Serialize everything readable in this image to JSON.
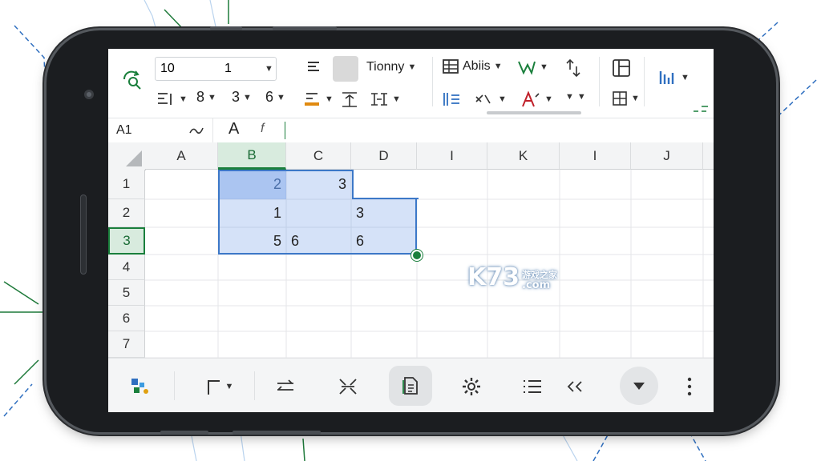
{
  "toolbar": {
    "font_size": "10",
    "font_option": "1",
    "font_name": "Tionny",
    "style_label": "Abiis",
    "row2_num1": "8",
    "row2_num2": "3",
    "row2_num3": "6"
  },
  "formula_bar": {
    "cell_ref": "A1",
    "fx_label": "A",
    "f_icon": "f"
  },
  "sheet": {
    "columns": [
      "A",
      "B",
      "C",
      "D",
      "I",
      "K",
      "I",
      "J"
    ],
    "rows": [
      "1",
      "2",
      "3",
      "4",
      "5",
      "6",
      "7"
    ],
    "cells": {
      "B1": "2",
      "C1": "3",
      "B2": "1",
      "D2": "3",
      "B3": "5",
      "C3": "6",
      "D3": "6"
    },
    "selected_column": "B",
    "selected_row": "3"
  },
  "watermark": {
    "logo": "K73",
    "site_cn": "游戏之家",
    "domain": ".com"
  },
  "icons": {
    "search": "search-icon",
    "settings": "gear-icon",
    "list": "list-icon",
    "more": "more-vertical-icon"
  },
  "colors": {
    "accent_green": "#1a7f3c",
    "selection_blue": "#3c78c8",
    "phone_frame": "#1b1d20"
  }
}
